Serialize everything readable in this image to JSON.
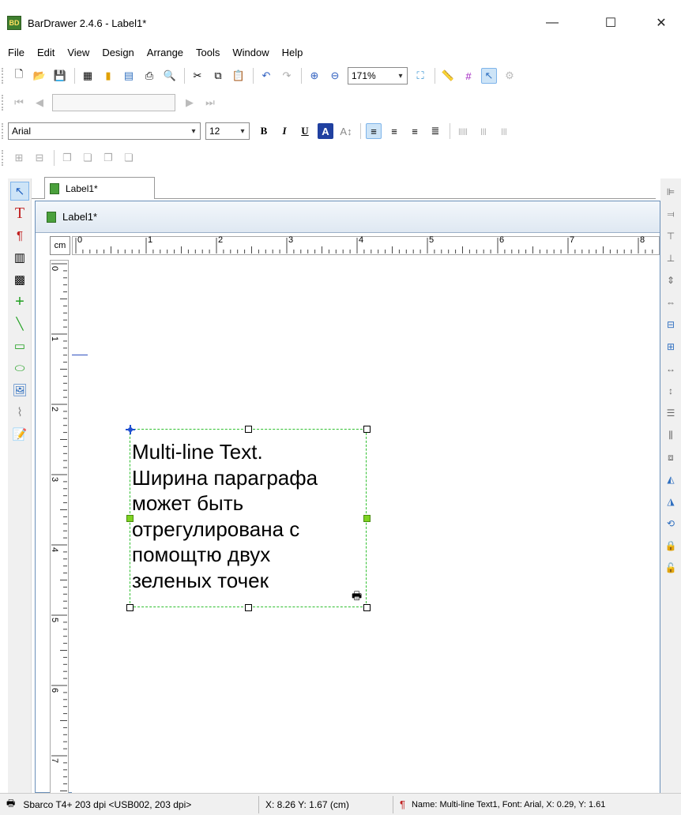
{
  "window": {
    "title": "BarDrawer 2.4.6 - Label1*",
    "app_icon_text": "BD",
    "minimize_glyph": "—",
    "maximize_glyph": "☐",
    "close_glyph": "✕"
  },
  "menu": [
    "File",
    "Edit",
    "View",
    "Design",
    "Arrange",
    "Tools",
    "Window",
    "Help"
  ],
  "toolbar": {
    "zoom_value": "171%",
    "font_name": "Arial",
    "font_size": "12",
    "bold_label": "B",
    "italic_label": "I",
    "underline_label": "U"
  },
  "tabs": {
    "active": "Label1*"
  },
  "document": {
    "title": "Label1*",
    "ruler_unit": "cm",
    "ruler_h_marks": [
      "0",
      "1",
      "2",
      "3",
      "4",
      "5",
      "6",
      "7",
      "8"
    ],
    "ruler_v_marks": [
      "0",
      "1",
      "2",
      "3",
      "4",
      "5",
      "6",
      "7"
    ]
  },
  "text_object": {
    "content": "Multi-line Text.\nШирина параграфа\nможет быть\nотрегулирована с\nпомощтю двух\nзеленых точек"
  },
  "status": {
    "printer": "Sbarco T4+ 203 dpi <USB002, 203 dpi>",
    "coordinates": "X: 8.26  Y: 1.67 (cm)",
    "selection_info": "Name: Multi-line Text1, Font: Arial, X: 0.29, Y: 1.61"
  },
  "colors": {
    "selection_dash": "#30c030",
    "resize_handle_green": "#7ed321",
    "accent_blue": "#3050c0",
    "app_icon_green": "#3f7f2f"
  }
}
